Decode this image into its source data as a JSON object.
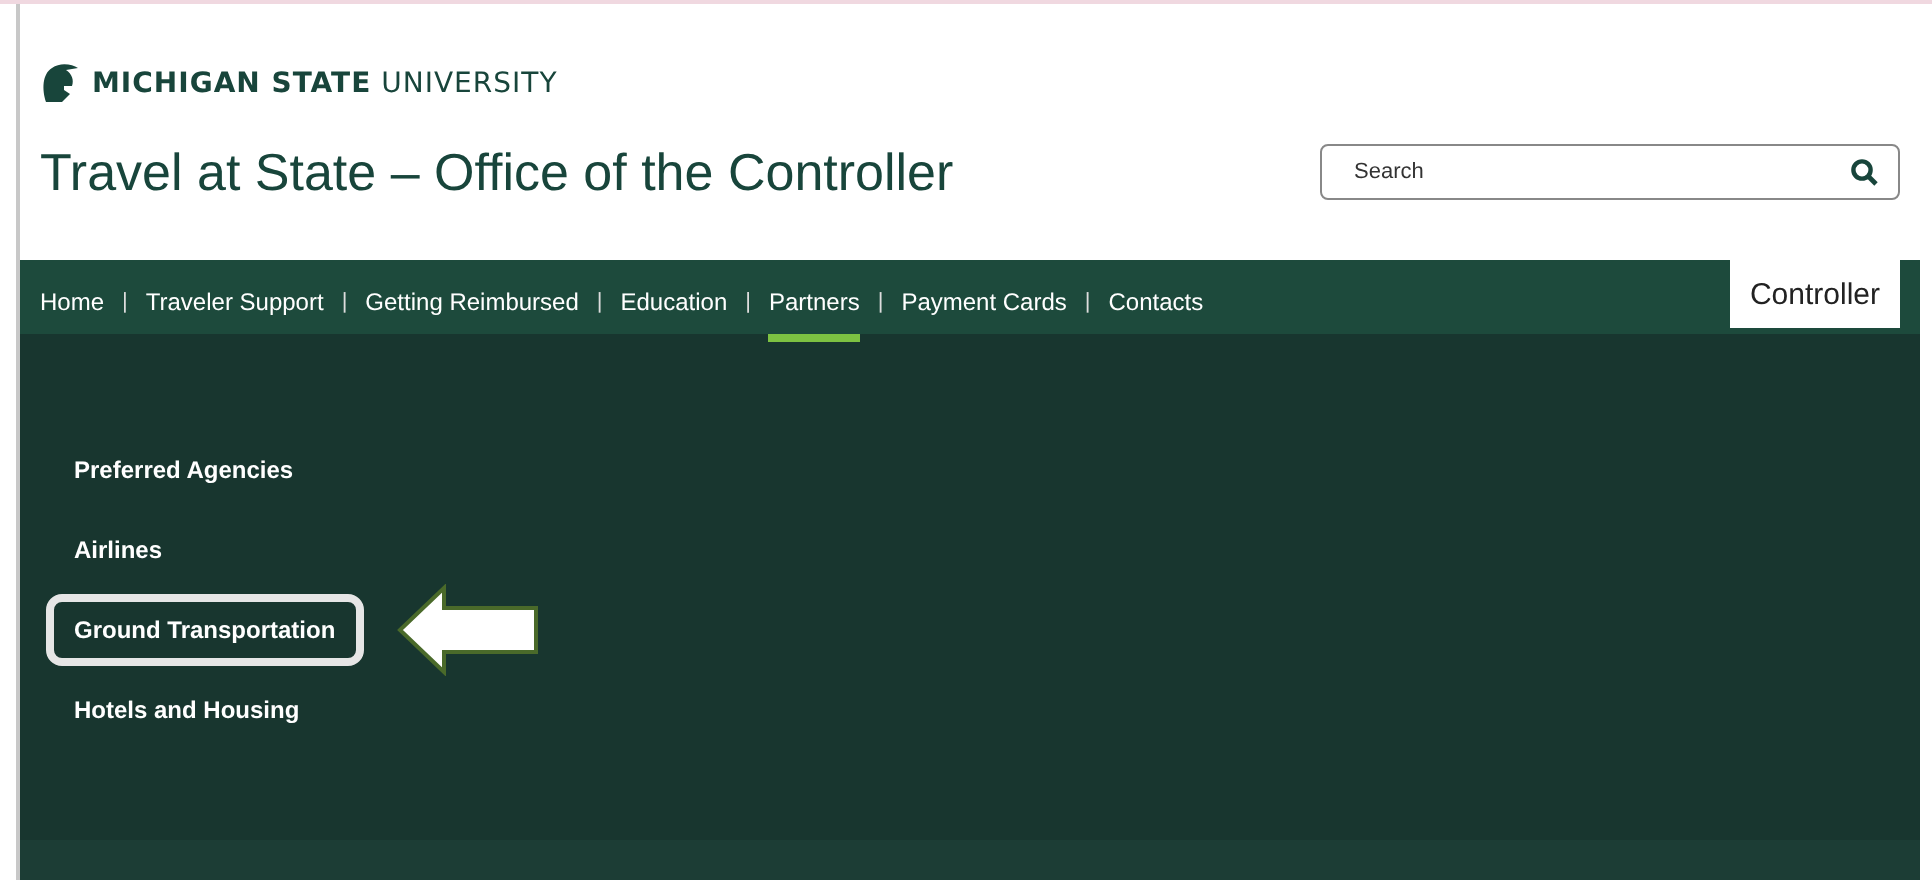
{
  "brand": {
    "bold": "MICHIGAN STATE",
    "light": "UNIVERSITY"
  },
  "site_title": "Travel at State – Office of the Controller",
  "search": {
    "placeholder": "Search"
  },
  "nav": {
    "items": [
      {
        "label": "Home",
        "selected": false
      },
      {
        "label": "Traveler Support",
        "selected": false
      },
      {
        "label": "Getting Reimbursed",
        "selected": false
      },
      {
        "label": "Education",
        "selected": false
      },
      {
        "label": "Partners",
        "selected": true
      },
      {
        "label": "Payment Cards",
        "selected": false
      },
      {
        "label": "Contacts",
        "selected": false
      }
    ],
    "separator": "|",
    "controller_tab": "Controller"
  },
  "submenu": [
    {
      "label": "Preferred Agencies",
      "highlighted": false
    },
    {
      "label": "Airlines",
      "highlighted": false
    },
    {
      "label": "Ground Transportation",
      "highlighted": true
    },
    {
      "label": "Hotels and Housing",
      "highlighted": false
    }
  ]
}
